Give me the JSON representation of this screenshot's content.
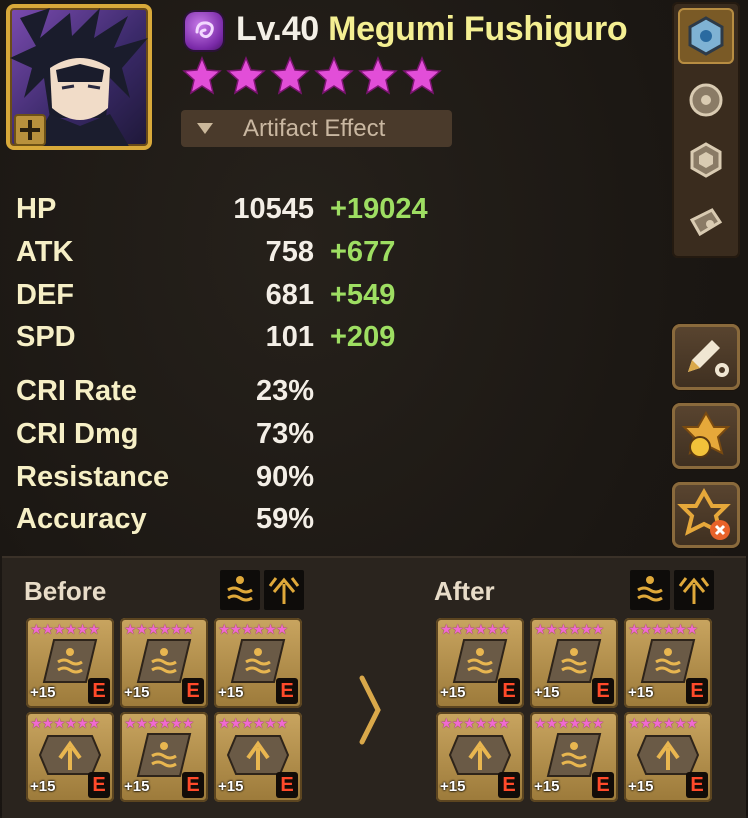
{
  "header": {
    "level": "Lv.40",
    "name": "Megumi Fushiguro",
    "stars": 6,
    "element_icon": "dark-element-icon",
    "artifact_button": "Artifact Effect"
  },
  "stats": [
    {
      "label": "HP",
      "base": "10545",
      "bonus": "+19024"
    },
    {
      "label": "ATK",
      "base": "758",
      "bonus": "+677"
    },
    {
      "label": "DEF",
      "base": "681",
      "bonus": "+549"
    },
    {
      "label": "SPD",
      "base": "101",
      "bonus": "+209"
    },
    {
      "label": "CRI Rate",
      "base": "23%",
      "bonus": ""
    },
    {
      "label": "CRI Dmg",
      "base": "73%",
      "bonus": ""
    },
    {
      "label": "Resistance",
      "base": "90%",
      "bonus": ""
    },
    {
      "label": "Accuracy",
      "base": "59%",
      "bonus": ""
    }
  ],
  "side_tabs": [
    "rune-tab-icon",
    "artifact-tab-icon",
    "gem-tab-icon",
    "skill-tab-icon"
  ],
  "side_buttons": [
    "edit-settings-icon",
    "rune-equip-icon",
    "rune-remove-icon"
  ],
  "compare": {
    "before_label": "Before",
    "after_label": "After",
    "set_icons": [
      "fatal-set-icon",
      "energy-set-icon"
    ],
    "before_runes": [
      {
        "level": "+15",
        "grade": "E",
        "set": "fatal"
      },
      {
        "level": "+15",
        "grade": "E",
        "set": "fatal"
      },
      {
        "level": "+15",
        "grade": "E",
        "set": "fatal"
      },
      {
        "level": "+15",
        "grade": "E",
        "set": "energy"
      },
      {
        "level": "+15",
        "grade": "E",
        "set": "fatal"
      },
      {
        "level": "+15",
        "grade": "E",
        "set": "energy"
      }
    ],
    "after_runes": [
      {
        "level": "+15",
        "grade": "E",
        "set": "fatal"
      },
      {
        "level": "+15",
        "grade": "E",
        "set": "fatal"
      },
      {
        "level": "+15",
        "grade": "E",
        "set": "fatal"
      },
      {
        "level": "+15",
        "grade": "E",
        "set": "energy"
      },
      {
        "level": "+15",
        "grade": "E",
        "set": "fatal"
      },
      {
        "level": "+15",
        "grade": "E",
        "set": "energy"
      }
    ]
  },
  "colors": {
    "name": "#f4ef92",
    "stat_label": "#f6efc6",
    "bonus": "#9ede62",
    "star": "#e24ed8",
    "gold_frame": "#d8a93a"
  }
}
